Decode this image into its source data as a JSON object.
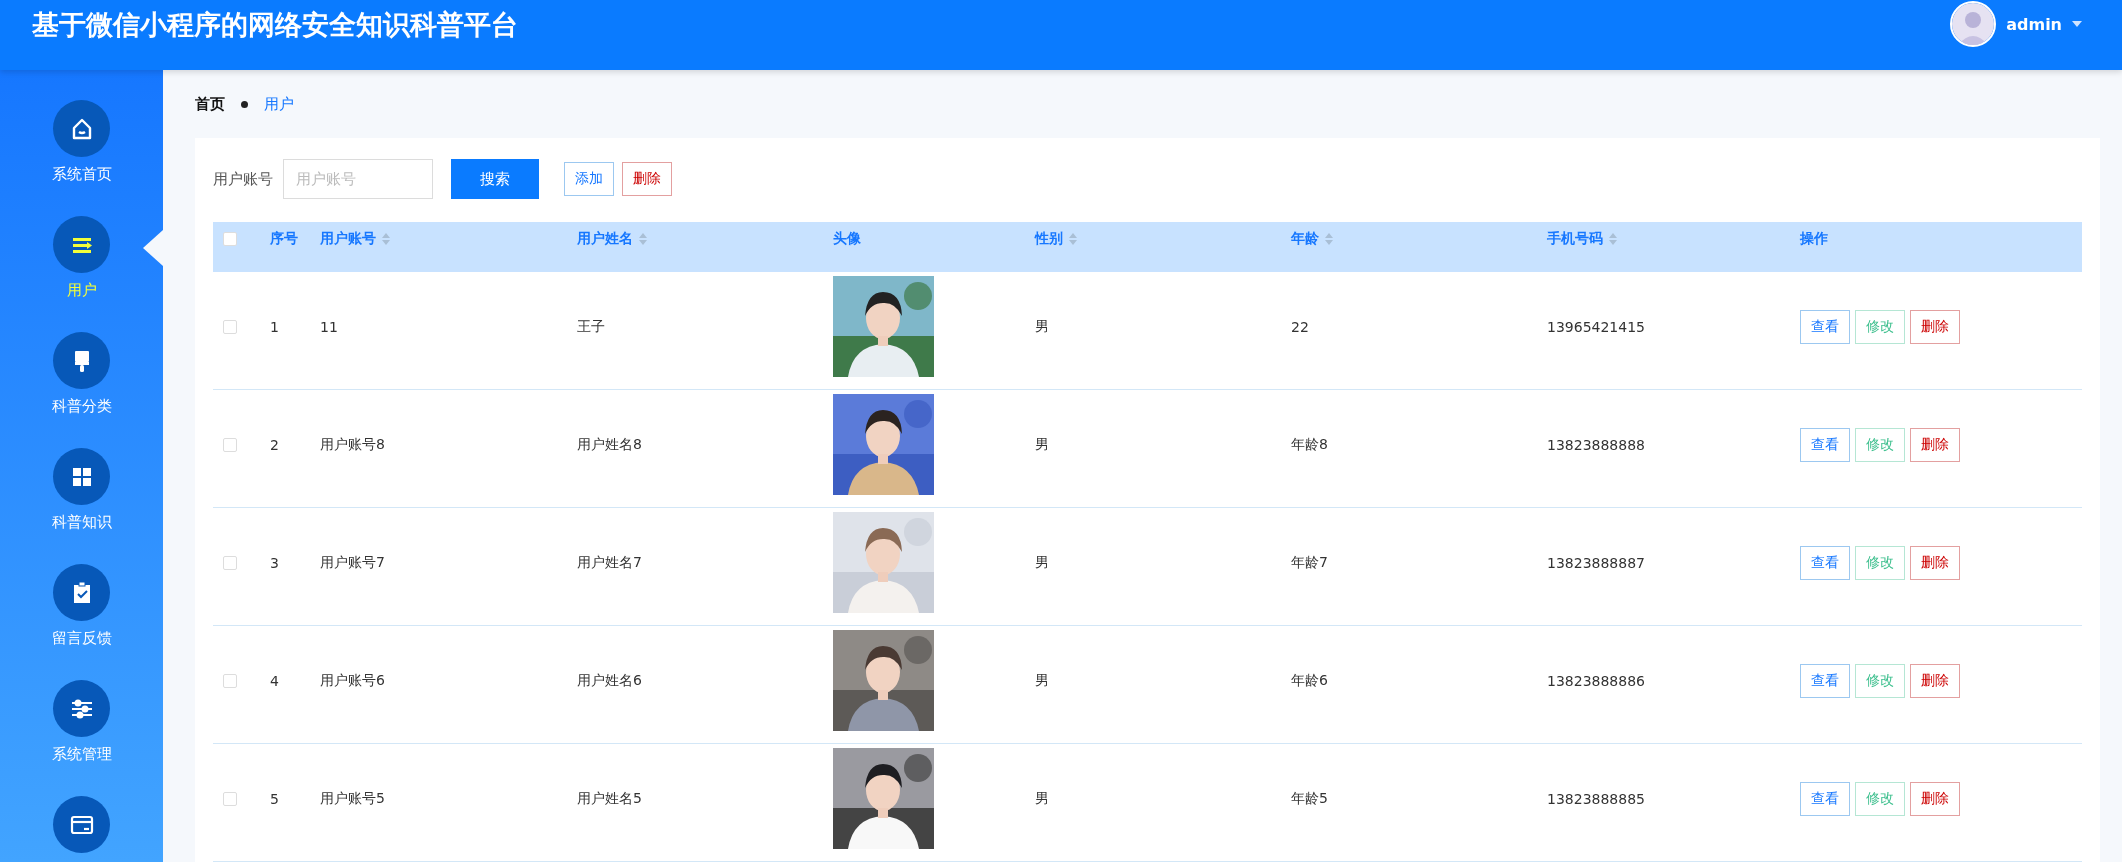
{
  "header": {
    "title": "基于微信小程序的网络安全知识科普平台",
    "user": {
      "name": "admin"
    }
  },
  "sidebar": {
    "items": [
      {
        "kind": "home",
        "label": "系统首页",
        "selected": false
      },
      {
        "kind": "list",
        "label": "用户",
        "selected": true
      },
      {
        "kind": "brush",
        "label": "科普分类",
        "selected": false
      },
      {
        "kind": "grid",
        "label": "科普知识",
        "selected": false
      },
      {
        "kind": "clipboard",
        "label": "留言反馈",
        "selected": false
      },
      {
        "kind": "sliders",
        "label": "系统管理",
        "selected": false
      },
      {
        "kind": "card"
      }
    ]
  },
  "breadcrumb": [
    {
      "label": "首页",
      "selected": false
    },
    {
      "label": "用户",
      "selected": true
    }
  ],
  "toolbar": {
    "search_label": "用户账号",
    "search_field": {
      "placeholder": "用户账号"
    },
    "search_button": "搜索",
    "add_button": "添加",
    "delete_button": "删除"
  },
  "table": {
    "select_all": {
      "checked": false
    },
    "columns": [
      {
        "label": "序号",
        "sortable": false
      },
      {
        "label": "用户账号",
        "sortable": true
      },
      {
        "label": "用户姓名",
        "sortable": true
      },
      {
        "label": "头像",
        "sortable": false
      },
      {
        "label": "性别",
        "sortable": true
      },
      {
        "label": "年龄",
        "sortable": true
      },
      {
        "label": "手机号码",
        "sortable": true
      },
      {
        "label": "操作",
        "sortable": false
      }
    ],
    "rows": [
      {
        "checked": false,
        "index": "1",
        "account": "11",
        "name": "王子",
        "gender": "男",
        "age": "22",
        "phone": "13965421415",
        "actions": [
          "查看",
          "修改",
          "删除"
        ]
      },
      {
        "checked": false,
        "index": "2",
        "account": "用户账号8",
        "name": "用户姓名8",
        "gender": "男",
        "age": "年龄8",
        "phone": "13823888888",
        "actions": [
          "查看",
          "修改",
          "删除"
        ]
      },
      {
        "checked": false,
        "index": "3",
        "account": "用户账号7",
        "name": "用户姓名7",
        "gender": "男",
        "age": "年龄7",
        "phone": "13823888887",
        "actions": [
          "查看",
          "修改",
          "删除"
        ]
      },
      {
        "checked": false,
        "index": "4",
        "account": "用户账号6",
        "name": "用户姓名6",
        "gender": "男",
        "age": "年龄6",
        "phone": "13823888886",
        "actions": [
          "查看",
          "修改",
          "删除"
        ]
      },
      {
        "checked": false,
        "index": "5",
        "account": "用户账号5",
        "name": "用户姓名5",
        "gender": "男",
        "age": "年龄5",
        "phone": "13823888885",
        "actions": [
          "查看",
          "修改",
          "删除"
        ]
      }
    ]
  }
}
